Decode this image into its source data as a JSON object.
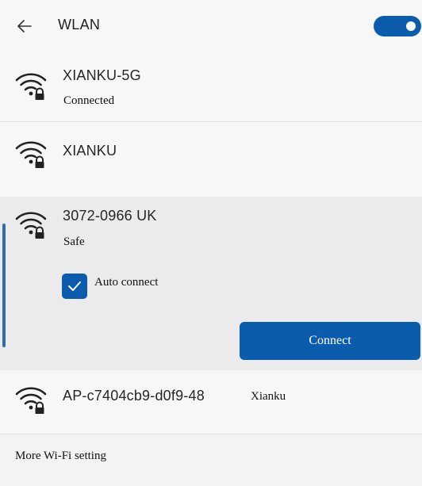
{
  "header": {
    "title": "WLAN",
    "wifi_enabled": true
  },
  "networks": [
    {
      "name": "XIANKU-5G",
      "status": "Connected",
      "secured": true
    },
    {
      "name": "XIANKU",
      "secured": true
    },
    {
      "name": "3072-0966 UK",
      "status": "Safe",
      "secured": true,
      "expanded": true,
      "auto_connect_label": "Auto connect",
      "auto_connect_checked": true,
      "connect_label": "Connect"
    },
    {
      "name": "AP-c7404cb9-d0f9-48",
      "suffix": "Xianku",
      "secured": true
    }
  ],
  "footer": {
    "more_settings_label": "More Wi-Fi setting"
  },
  "colors": {
    "accent": "#0b5cad",
    "panel_bg": "#f3f3f3",
    "expanded_row_bg": "#ebebeb"
  },
  "icons": {
    "back": "arrow-left-icon",
    "network": "wifi-secured-icon",
    "check": "checkmark-icon"
  }
}
